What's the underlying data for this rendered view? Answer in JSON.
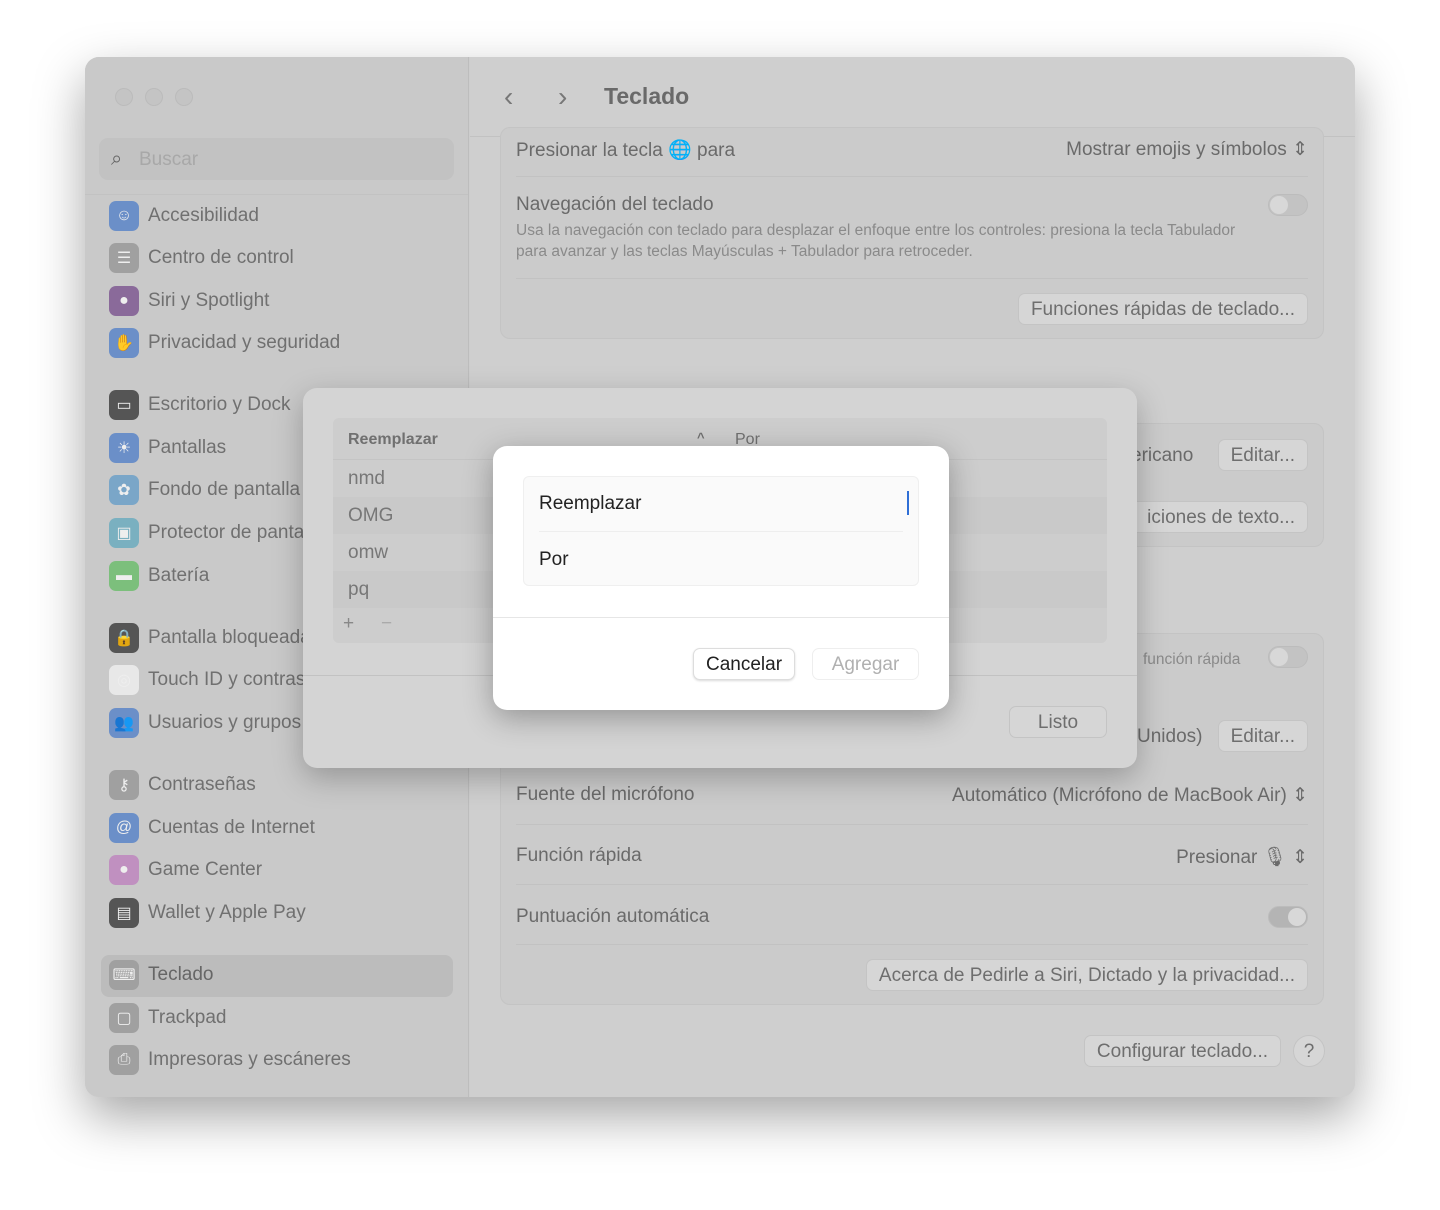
{
  "window": {
    "title": "Teclado"
  },
  "sidebar": {
    "search_placeholder": "Buscar",
    "items": [
      {
        "label": "Accesibilidad",
        "icon": "accessibility-icon",
        "color": "#6b8fc8"
      },
      {
        "label": "Centro de control",
        "icon": "control-center-icon",
        "color": "#a0a0a0"
      },
      {
        "label": "Siri y Spotlight",
        "icon": "siri-icon",
        "color": "#8a6a9a"
      },
      {
        "label": "Privacidad y seguridad",
        "icon": "hand-icon",
        "color": "#6b8fc8"
      },
      {
        "label": "Escritorio y Dock",
        "icon": "dock-icon",
        "color": "#555555"
      },
      {
        "label": "Pantallas",
        "icon": "sun-icon",
        "color": "#6b8fc8"
      },
      {
        "label": "Fondo de pantalla",
        "icon": "wallpaper-icon",
        "color": "#7aa6c8"
      },
      {
        "label": "Protector de pantalla",
        "icon": "screensaver-icon",
        "color": "#7ab0c0"
      },
      {
        "label": "Batería",
        "icon": "battery-icon",
        "color": "#7cbf7c"
      },
      {
        "label": "Pantalla bloqueada",
        "icon": "lock-icon",
        "color": "#555555"
      },
      {
        "label": "Touch ID y contraseña",
        "icon": "fingerprint-icon",
        "color": "#e8e8e8"
      },
      {
        "label": "Usuarios y grupos",
        "icon": "users-icon",
        "color": "#6b8fc8"
      },
      {
        "label": "Contraseñas",
        "icon": "key-icon",
        "color": "#a0a0a0"
      },
      {
        "label": "Cuentas de Internet",
        "icon": "at-icon",
        "color": "#6b8fc8"
      },
      {
        "label": "Game Center",
        "icon": "game-center-icon",
        "color": "#c090c0"
      },
      {
        "label": "Wallet y Apple Pay",
        "icon": "wallet-icon",
        "color": "#555555"
      },
      {
        "label": "Teclado",
        "icon": "keyboard-icon",
        "color": "#a0a0a0"
      },
      {
        "label": "Trackpad",
        "icon": "trackpad-icon",
        "color": "#a0a0a0"
      },
      {
        "label": "Impresoras y escáneres",
        "icon": "printer-icon",
        "color": "#a0a0a0"
      }
    ]
  },
  "main": {
    "globe_label_pre": "Presionar la tecla",
    "globe_label_post": "para",
    "globe_value": "Mostrar emojis y símbolos",
    "nav_label": "Navegación del teclado",
    "nav_desc": "Usa la navegación con teclado para desplazar el enfoque entre los controles: presiona la tecla Tabulador para avanzar y las teclas Mayúsculas + Tabulador para retroceder.",
    "nav_on": false,
    "shortcuts_button": "Funciones rápidas de teclado...",
    "input_partial": "ericano",
    "edit1": "Editar...",
    "text_replace_partial": "iciones de texto...",
    "shortcut_partial": "función rápida",
    "lang_partial": "Unidos)",
    "edit2": "Editar...",
    "mic_label": "Fuente del micrófono",
    "mic_value": "Automático (Micrófono de MacBook Air)",
    "shortcut_label": "Función rápida",
    "shortcut_value": "Presionar",
    "punct_label": "Puntuación automática",
    "punct_on": true,
    "about_button": "Acerca de Pedirle a Siri, Dictado y la privacidad...",
    "setup_button": "Configurar teclado...",
    "help": "?"
  },
  "sheet": {
    "col1": "Reemplazar",
    "col2": "Por",
    "rows": [
      "nmd",
      "OMG",
      "omw",
      "pq"
    ],
    "add": "+",
    "remove": "−",
    "done": "Listo"
  },
  "dialog": {
    "replace_placeholder": "Reemplazar",
    "with_placeholder": "Por",
    "cancel": "Cancelar",
    "add": "Agregar"
  }
}
